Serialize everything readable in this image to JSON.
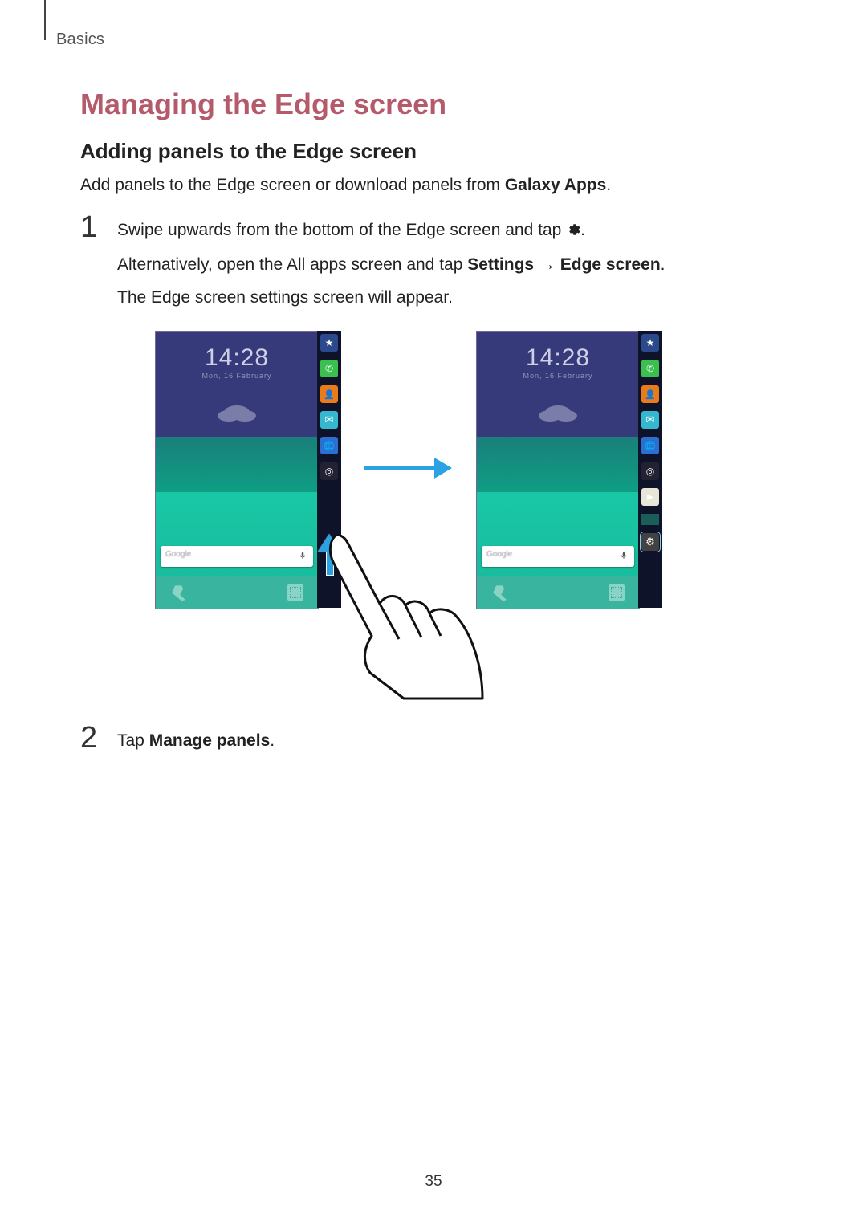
{
  "breadcrumb": "Basics",
  "section_title": "Managing the Edge screen",
  "sub_title": "Adding panels to the Edge screen",
  "intro_pre_bold": "Add panels to the Edge screen or download panels from ",
  "intro_bold": "Galaxy Apps",
  "intro_post_bold": ".",
  "steps": [
    {
      "line1_a": "Swipe upwards from the bottom of the Edge screen and tap ",
      "line1_b": ".",
      "line2_a": "Alternatively, open the All apps screen and tap ",
      "line2_bold1": "Settings",
      "line2_arrow": " → ",
      "line2_bold2": "Edge screen",
      "line2_b": ".",
      "line3": "The Edge screen settings screen will appear."
    },
    {
      "line1_a": "Tap ",
      "line1_bold": "Manage panels",
      "line1_b": "."
    }
  ],
  "figure": {
    "clock_time": "14:28",
    "clock_sub": "Mon, 16 February",
    "search_placeholder": "Google",
    "edge_tiles_left": [
      "star",
      "phone",
      "contact",
      "msg",
      "browser",
      "camera"
    ],
    "edge_tiles_right": [
      "star",
      "phone",
      "contact",
      "msg",
      "browser",
      "camera",
      "store",
      "mini",
      "gear"
    ]
  },
  "page_number": "35"
}
